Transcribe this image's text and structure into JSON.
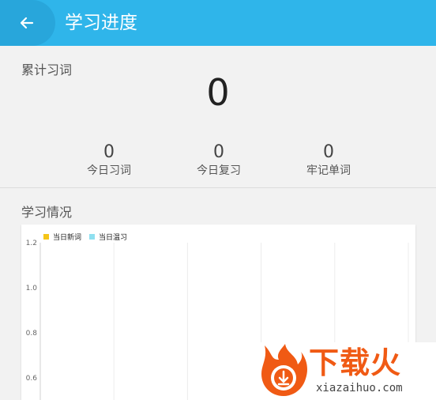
{
  "appbar": {
    "title": "学习进度",
    "back_icon": "arrow-left-icon"
  },
  "summary": {
    "total_label": "累计习词",
    "total_value": "0",
    "stats": [
      {
        "value": "0",
        "label": "今日习词"
      },
      {
        "value": "0",
        "label": "今日复习"
      },
      {
        "value": "0",
        "label": "牢记单词"
      }
    ]
  },
  "section": {
    "title": "学习情况"
  },
  "chart_data": {
    "type": "bar",
    "series": [
      {
        "name": "当日新词",
        "color": "#f5c518",
        "values": []
      },
      {
        "name": "当日温习",
        "color": "#8fe0f0",
        "values": []
      }
    ],
    "y_ticks": [
      "1.2",
      "1.0",
      "0.8",
      "0.6"
    ],
    "ylim_visible": [
      0.6,
      1.2
    ],
    "grid": true,
    "legend_position": "top-left"
  },
  "watermark": {
    "brand": "下载火",
    "url": "xiazaihuo.com"
  }
}
